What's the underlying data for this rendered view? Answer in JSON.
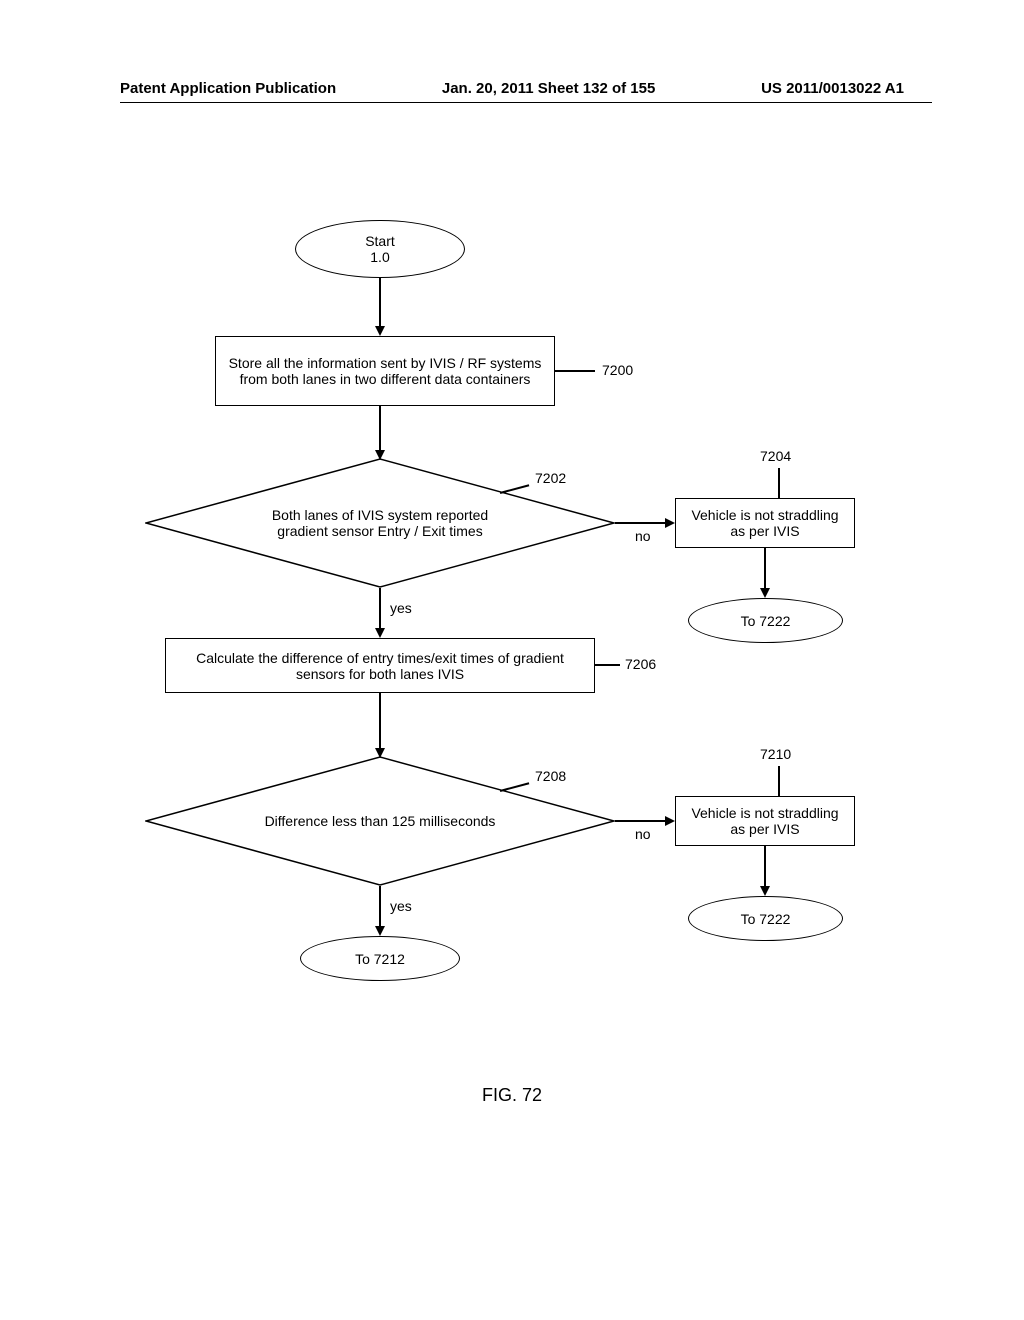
{
  "header": {
    "left": "Patent Application Publication",
    "center": "Jan. 20, 2011  Sheet 132 of 155",
    "right": "US 2011/0013022 A1"
  },
  "flowchart": {
    "start": {
      "line1": "Start",
      "line2": "1.0"
    },
    "box_7200": "Store all the information sent by IVIS / RF systems from both lanes in two different data containers",
    "ref_7200": "7200",
    "diamond_7202": "Both lanes of IVIS system reported gradient sensor Entry / Exit times",
    "ref_7202": "7202",
    "ref_7204": "7204",
    "box_7204": "Vehicle is not straddling as per IVIS",
    "conn_7204": "To 7222",
    "box_7206": "Calculate the difference of entry times/exit times of gradient sensors for both lanes IVIS",
    "ref_7206": "7206",
    "diamond_7208": "Difference less than 125 milliseconds",
    "ref_7208": "7208",
    "ref_7210": "7210",
    "box_7210": "Vehicle is not straddling as per IVIS",
    "conn_7210": "To 7222",
    "conn_7212": "To 7212",
    "label_yes": "yes",
    "label_no": "no"
  },
  "figure_title": "FIG. 72"
}
